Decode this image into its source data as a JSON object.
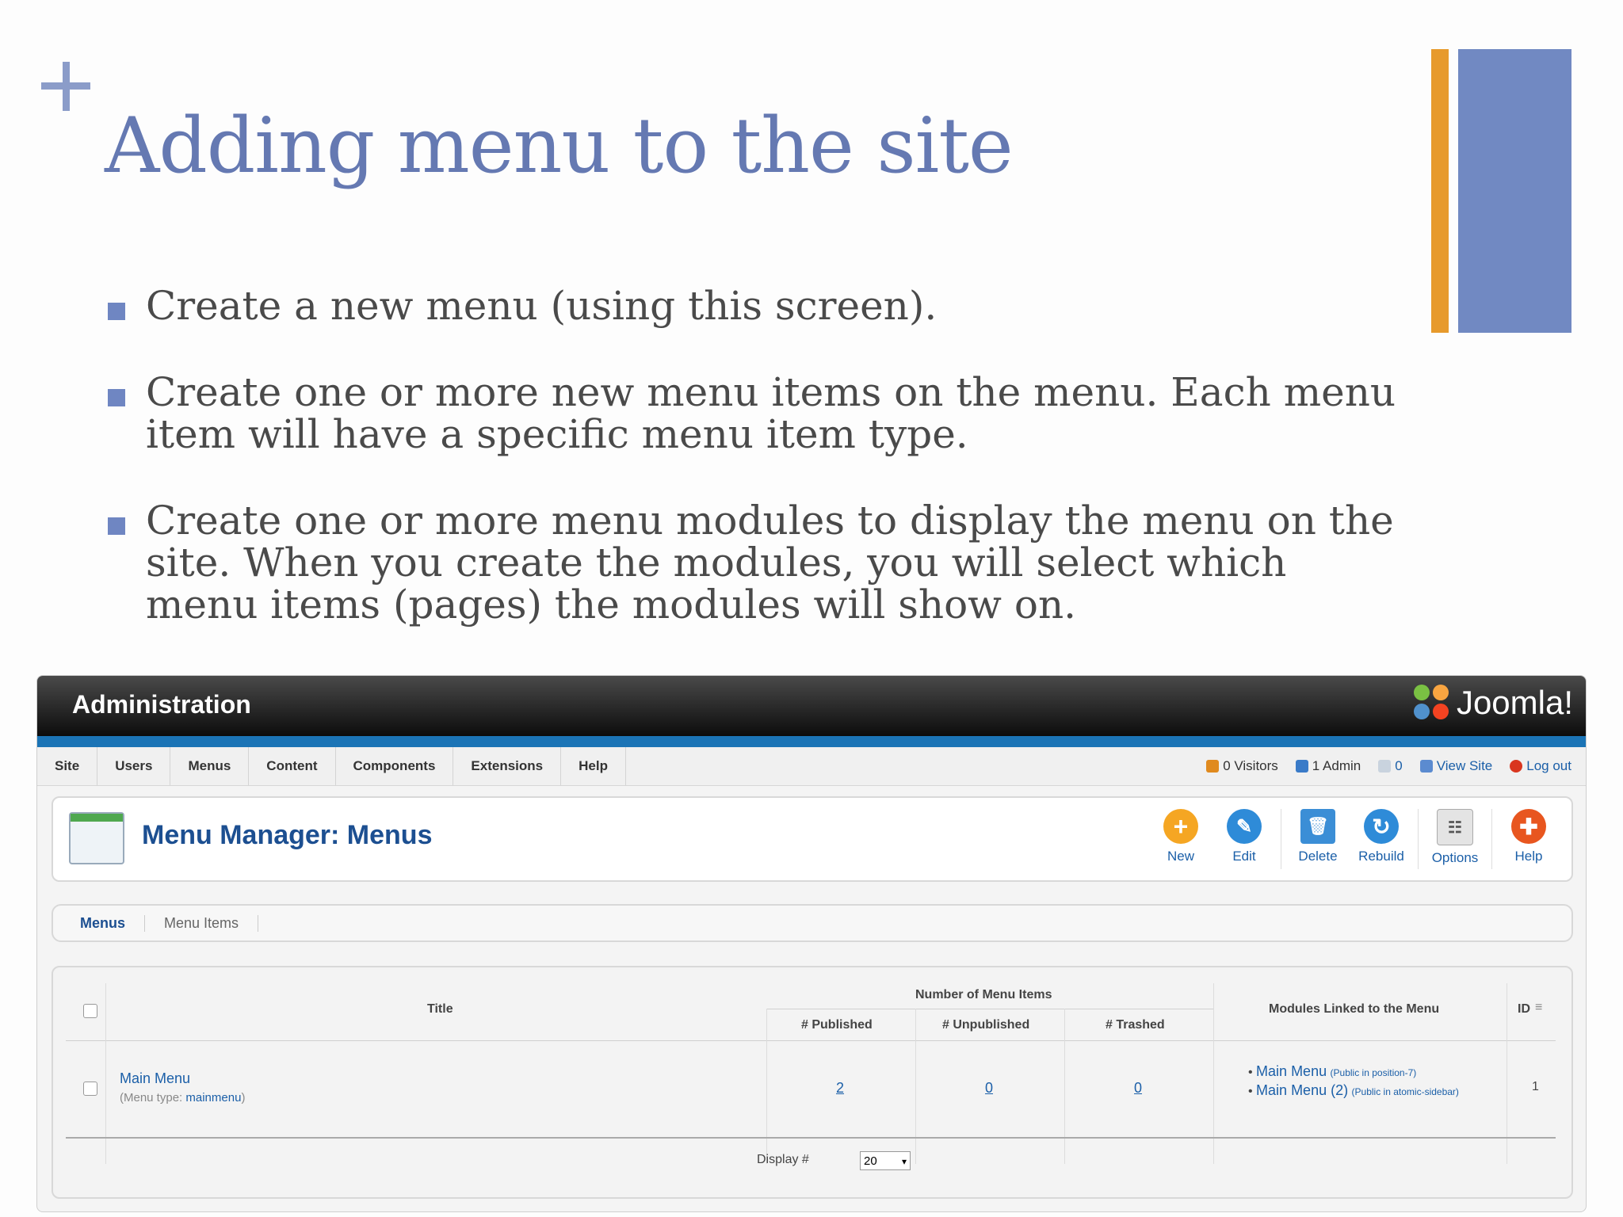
{
  "slide": {
    "title": "Adding menu to the site",
    "bullets": [
      "Create a new menu (using this screen).",
      "Create one or more new menu items on the menu. Each menu item will have a specific menu item type.",
      "Create one or more menu modules to display the menu on the site. When you create the modules, you will select which menu items (pages) the modules will show on."
    ]
  },
  "joomla": {
    "header": {
      "title": "Administration",
      "logo_text": "Joomla!"
    },
    "menu": [
      "Site",
      "Users",
      "Menus",
      "Content",
      "Components",
      "Extensions",
      "Help"
    ],
    "status": {
      "visitors": "0 Visitors",
      "admins": "1 Admin",
      "messages": "0",
      "view_site": "View Site",
      "logout": "Log out"
    },
    "toolbar": {
      "title": "Menu Manager: Menus",
      "buttons": {
        "new": "New",
        "edit": "Edit",
        "delete": "Delete",
        "rebuild": "Rebuild",
        "options": "Options",
        "help": "Help"
      }
    },
    "subtabs": [
      "Menus",
      "Menu Items"
    ],
    "table": {
      "headers": {
        "title": "Title",
        "number_group": "Number of Menu Items",
        "published": "# Published",
        "unpublished": "# Unpublished",
        "trashed": "# Trashed",
        "modules": "Modules Linked to the Menu",
        "id": "ID"
      },
      "rows": [
        {
          "title": "Main Menu",
          "menu_type_prefix": "(Menu type:",
          "menu_type": "mainmenu",
          "menu_type_suffix": ")",
          "published": "2",
          "unpublished": "0",
          "trashed": "0",
          "modules": [
            {
              "name": "Main Menu",
              "detail": "(Public in position-7)"
            },
            {
              "name": "Main Menu (2)",
              "detail": "(Public in atomic-sidebar)"
            }
          ],
          "id": "1"
        }
      ],
      "display_label": "Display #",
      "display_value": "20"
    }
  }
}
